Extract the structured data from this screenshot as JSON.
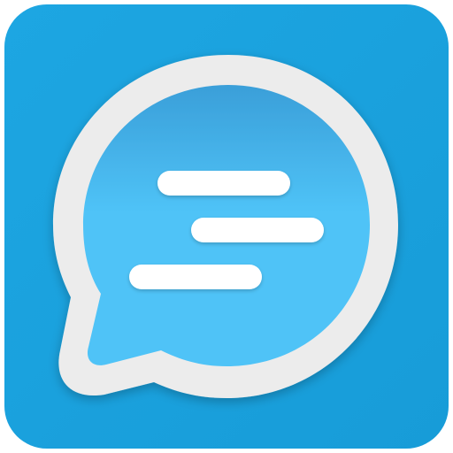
{
  "icon": {
    "name": "chat-bubble-app-icon",
    "colors": {
      "tile": "#1aa3e0",
      "bubble_fill_top": "#3a9fd9",
      "bubble_fill_bottom": "#4fc3f7",
      "bubble_border": "#ececec",
      "text_lines": "#ffffff"
    },
    "message_line_count": 3
  }
}
